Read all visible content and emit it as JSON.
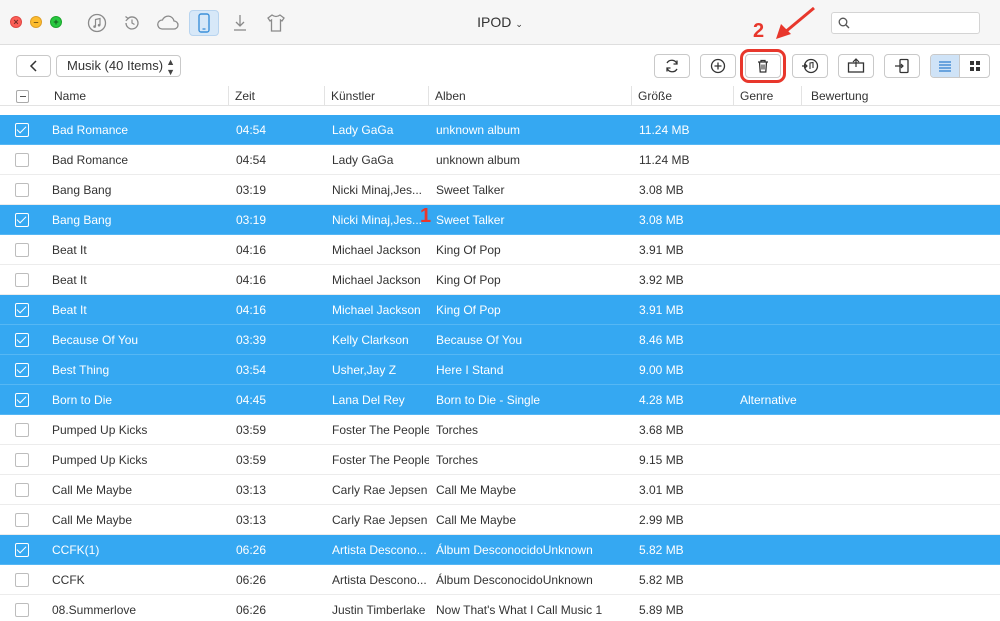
{
  "window": {
    "device_title": "IPOD",
    "device_chevron": "⌄"
  },
  "top_icons": [
    "music-icon",
    "restore-icon",
    "cloud-icon",
    "device-icon",
    "download-icon",
    "shirt-icon"
  ],
  "toolbar": {
    "category": "Musik (40 Items)"
  },
  "columns": {
    "name": "Name",
    "time": "Zeit",
    "artist": "Künstler",
    "album": "Alben",
    "size": "Größe",
    "genre": "Genre",
    "rating": "Bewertung"
  },
  "annotations": {
    "step1": "1",
    "step2": "2"
  },
  "rows": [
    {
      "selected": true,
      "name": "Bad Romance",
      "time": "04:54",
      "artist": "Lady GaGa",
      "album": "unknown album",
      "size": "11.24 MB",
      "genre": ""
    },
    {
      "selected": false,
      "name": "Bad Romance",
      "time": "04:54",
      "artist": "Lady GaGa",
      "album": "unknown album",
      "size": "11.24 MB",
      "genre": ""
    },
    {
      "selected": false,
      "name": "Bang Bang",
      "time": "03:19",
      "artist": "Nicki Minaj,Jes...",
      "album": "Sweet Talker",
      "size": "3.08 MB",
      "genre": ""
    },
    {
      "selected": true,
      "name": "Bang Bang",
      "time": "03:19",
      "artist": "Nicki Minaj,Jes...",
      "album": "Sweet Talker",
      "size": "3.08 MB",
      "genre": ""
    },
    {
      "selected": false,
      "name": "Beat It",
      "time": "04:16",
      "artist": "Michael Jackson",
      "album": "King Of Pop",
      "size": "3.91 MB",
      "genre": ""
    },
    {
      "selected": false,
      "name": "Beat It",
      "time": "04:16",
      "artist": "Michael Jackson",
      "album": "King Of Pop",
      "size": "3.92 MB",
      "genre": ""
    },
    {
      "selected": true,
      "name": "Beat It",
      "time": "04:16",
      "artist": "Michael Jackson",
      "album": "King Of Pop",
      "size": "3.91 MB",
      "genre": ""
    },
    {
      "selected": true,
      "name": "Because Of You",
      "time": "03:39",
      "artist": "Kelly Clarkson",
      "album": "Because Of You",
      "size": "8.46 MB",
      "genre": ""
    },
    {
      "selected": true,
      "name": "Best Thing",
      "time": "03:54",
      "artist": "Usher,Jay Z",
      "album": "Here I Stand",
      "size": "9.00 MB",
      "genre": ""
    },
    {
      "selected": true,
      "name": "Born to Die",
      "time": "04:45",
      "artist": "Lana Del Rey",
      "album": "Born to Die - Single",
      "size": "4.28 MB",
      "genre": "Alternative"
    },
    {
      "selected": false,
      "name": "Pumped Up Kicks",
      "time": "03:59",
      "artist": "Foster The People",
      "album": "Torches",
      "size": "3.68 MB",
      "genre": ""
    },
    {
      "selected": false,
      "name": "Pumped Up Kicks",
      "time": "03:59",
      "artist": "Foster The People",
      "album": "Torches",
      "size": "9.15 MB",
      "genre": ""
    },
    {
      "selected": false,
      "name": "Call Me Maybe",
      "time": "03:13",
      "artist": "Carly Rae Jepsen",
      "album": "Call Me Maybe",
      "size": "3.01 MB",
      "genre": ""
    },
    {
      "selected": false,
      "name": "Call Me Maybe",
      "time": "03:13",
      "artist": "Carly Rae Jepsen",
      "album": "Call Me Maybe",
      "size": "2.99 MB",
      "genre": ""
    },
    {
      "selected": true,
      "name": "CCFK(1)",
      "time": "06:26",
      "artist": "Artista Descono...",
      "album": "Álbum DesconocidoUnknown",
      "size": "5.82 MB",
      "genre": ""
    },
    {
      "selected": false,
      "name": "CCFK",
      "time": "06:26",
      "artist": "Artista Descono...",
      "album": "Álbum DesconocidoUnknown",
      "size": "5.82 MB",
      "genre": ""
    },
    {
      "selected": false,
      "name": "08.Summerlove",
      "time": "06:26",
      "artist": "Justin Timberlake",
      "album": "Now That's What I Call Music 1",
      "size": "5.89 MB",
      "genre": ""
    }
  ],
  "colors": {
    "selection": "#35a8f2",
    "annotation": "#e8372c"
  }
}
